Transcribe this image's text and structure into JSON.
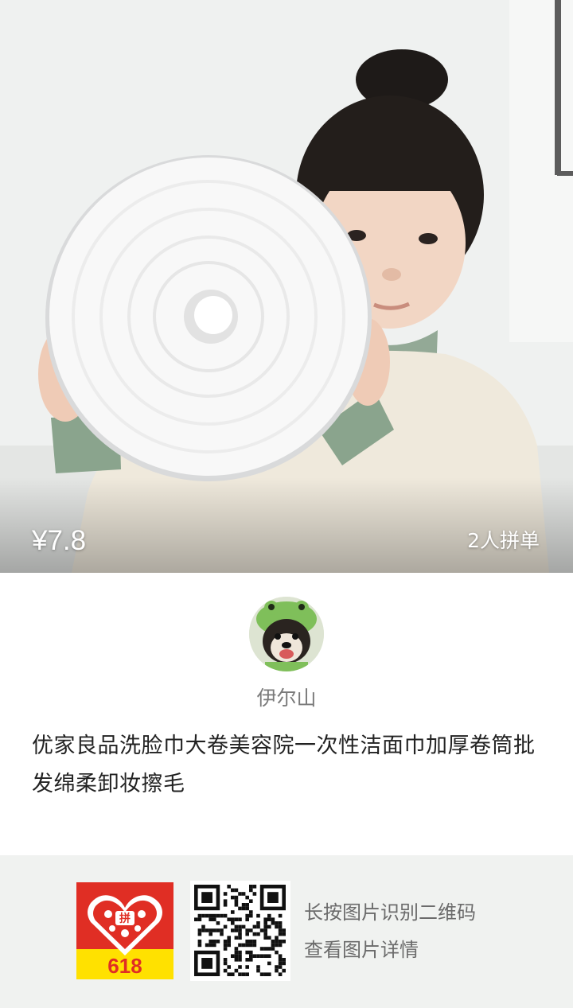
{
  "product": {
    "price": "¥7.8",
    "group_tag": "2人拼单",
    "title": "优家良品洗脸巾大卷美容院一次性洁面巾加厚卷筒批发绵柔卸妆擦毛"
  },
  "seller": {
    "name": "伊尔山"
  },
  "footer": {
    "logo_text": "618",
    "logo_center_char": "拼",
    "hint_line1": "长按图片识别二维码",
    "hint_line2": "查看图片详情"
  },
  "colors": {
    "logo_red": "#e02e24",
    "logo_yellow": "#ffe100",
    "footer_bg": "#f0f2f0"
  },
  "icons": {
    "app_logo": "pinduoduo-618-logo-icon",
    "qr": "qr-code-icon",
    "avatar": "dog-avatar-image"
  }
}
